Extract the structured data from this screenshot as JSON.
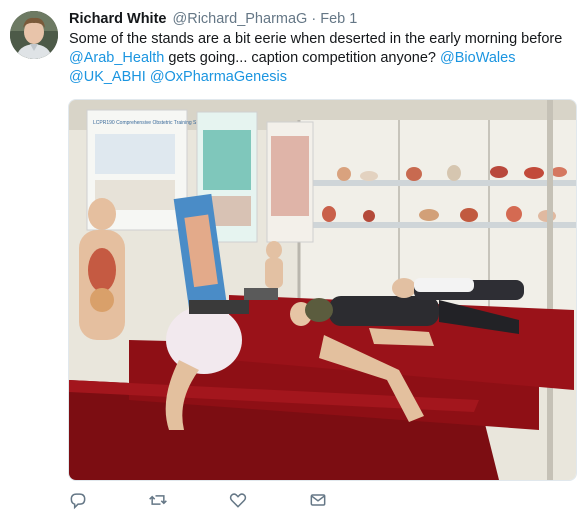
{
  "tweet": {
    "author_name": "Richard White",
    "author_handle": "@Richard_PharmaG",
    "separator": "·",
    "date": "Feb 1",
    "text_part1": "Some of the stands are a bit eerie when deserted in the early morning before",
    "mention_arab_health": "@Arab_Health",
    "text_part2": "gets going... caption competition anyone?",
    "mention_biowales": "@BioWales",
    "mention_uk_abhi": "@UK_ABHI",
    "mention_oxpharma": "@OxPharmaGenesis",
    "media_sign_text": "LCPR190 Comprehensive Obstetric Training System"
  },
  "icons": {
    "reply": "reply-icon",
    "retweet": "retweet-icon",
    "like": "heart-icon",
    "message": "envelope-icon"
  },
  "colors": {
    "link": "#1b95e0",
    "muted": "#657786",
    "table_cloth": "#8e0f15",
    "booth_wall": "#e9e6dc"
  }
}
